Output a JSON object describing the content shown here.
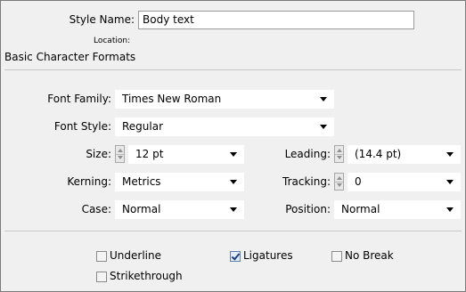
{
  "style_name": {
    "label": "Style Name:",
    "mnemonic": "N",
    "value": "Body text"
  },
  "location": {
    "label": "Location:"
  },
  "section_title": "Basic Character Formats",
  "font_family": {
    "label": "Font Family:",
    "mnemonic": "F",
    "value": "Times New Roman"
  },
  "font_style": {
    "label": "Font Style:",
    "mnemonic": "Y",
    "value": "Regular"
  },
  "size": {
    "label": "Size:",
    "mnemonic": "S",
    "value": "12 pt"
  },
  "leading": {
    "label": "Leading:",
    "mnemonic": "L",
    "value": "(14.4 pt)"
  },
  "kerning": {
    "label": "Kerning:",
    "mnemonic": "K",
    "value": "Metrics"
  },
  "tracking": {
    "label": "Tracking:",
    "mnemonic": "T",
    "value": "0"
  },
  "case": {
    "label": "Case:",
    "mnemonic": "C",
    "value": "Normal"
  },
  "position": {
    "label": "Position:",
    "mnemonic": "i",
    "value": "Normal"
  },
  "options": {
    "underline": {
      "label": "Underline",
      "mnemonic": "U",
      "checked": false
    },
    "ligatures": {
      "label": "Ligatures",
      "mnemonic": "g",
      "checked": true
    },
    "no_break": {
      "label": "No Break",
      "mnemonic": "B",
      "checked": false
    },
    "strikethrough": {
      "label": "Strikethrough",
      "mnemonic": "r",
      "checked": false
    }
  },
  "colors": {
    "background": "#f0f0f0",
    "field": "#ffffff",
    "check": "#1f3f88"
  }
}
